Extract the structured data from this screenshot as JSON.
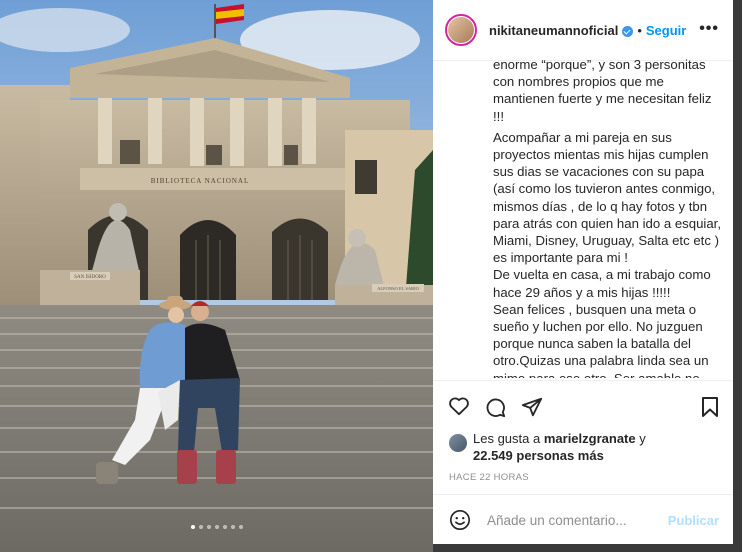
{
  "post": {
    "username": "nikitaneumannoficial",
    "separator": "•",
    "follow_label": "Seguir",
    "more_label": "•••",
    "caption": {
      "lines_top": [
        "enorme “porque”, y son 3 personitas",
        "con nombres propios que me",
        "mantienen fuerte y me necesitan feliz",
        "!!!"
      ],
      "para2": "Acompañar a mi pareja en sus proyectos mientas mis hijas cumplen sus dias se vacaciones con su papa (así como los tuvieron antes conmigo, mismos días , de lo q hay fotos y tbn para atrás con quien han ido a esquiar, Miami, Disney, Uruguay, Salta etc etc ) es importante para mi !",
      "para3": "De vuelta en casa, a mi trabajo como hace 29 años y a mis hijas !!!!!",
      "para4": "Sean felices , busquen una meta o sueño y luchen por ello. No juzguen porque nunca saben la batalla del otro.Quizas una palabra linda sea un mimo para ese otro. Ser amable no cuesta nada. Y el amor es la única"
    },
    "likes": {
      "prefix": "Les gusta a",
      "user": "marielzgranate",
      "connector": "y",
      "count": "22.549 personas más"
    },
    "timestamp": "HACE 22 HORAS",
    "comment_placeholder": "Añade un comentario...",
    "publish_label": "Publicar"
  },
  "photo": {
    "building_sign": "BIBLIOTECA NACIONAL",
    "statue_left_plaque": "SAN ISIDORO",
    "statue_right_plaque": "ALFONSO EL SABIO",
    "carousel_total": 7,
    "carousel_active": 1
  },
  "colors": {
    "accent": "#0095f6",
    "publish_disabled": "#b2dffc",
    "text": "#262626",
    "muted": "#8e8e8e"
  }
}
